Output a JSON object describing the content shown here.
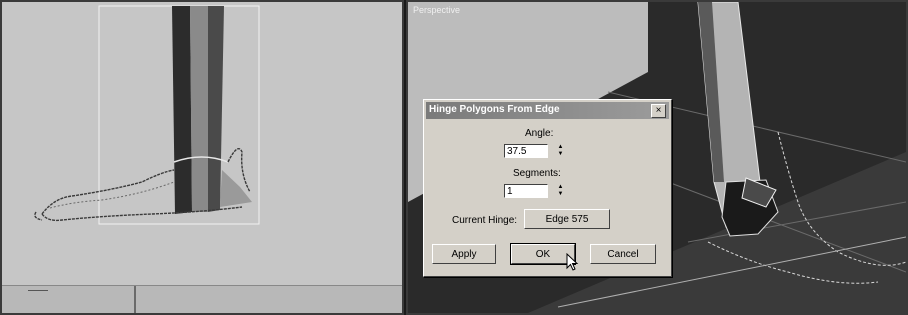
{
  "viewports": {
    "left": {
      "label": ""
    },
    "right": {
      "label": "Perspective"
    }
  },
  "dialog": {
    "title": "Hinge Polygons From Edge",
    "close_glyph": "×",
    "angle_label": "Angle:",
    "angle_value": "37.5",
    "segments_label": "Segments:",
    "segments_value": "1",
    "current_hinge_label": "Current Hinge:",
    "current_hinge_button": "Edge 575",
    "apply_label": "Apply",
    "ok_label": "OK",
    "cancel_label": "Cancel",
    "spinner_up": "▲",
    "spinner_down": "▼"
  },
  "colors": {
    "viewport_bg": "#c6c6c6",
    "dialog_bg": "#d4d0c8",
    "titlebar": "#8c8c8c"
  }
}
